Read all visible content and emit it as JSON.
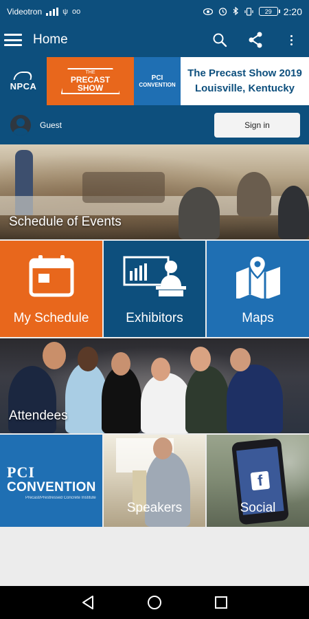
{
  "status_bar": {
    "carrier": "Videotron",
    "battery": "29",
    "time": "2:20"
  },
  "app_bar": {
    "title": "Home",
    "icons": [
      "menu-icon",
      "search-icon",
      "share-icon",
      "more-vert-icon"
    ]
  },
  "banner": {
    "npca_logo": "NPCA",
    "precast_logo_top": "THE",
    "precast_logo_line1": "PRECAST",
    "precast_logo_line2": "SHOW",
    "convention_logo_top": "PCI",
    "convention_logo_bottom": "CONVENTION",
    "show_title": "The Precast Show 2019",
    "show_location": "Louisville, Kentucky"
  },
  "guest_bar": {
    "user_label": "Guest",
    "sign_in_label": "Sign in"
  },
  "tiles": {
    "schedule_of_events": "Schedule of Events",
    "my_schedule": "My Schedule",
    "exhibitors": "Exhibitors",
    "maps": "Maps",
    "attendees": "Attendees",
    "convention_pci": "PCI",
    "convention_name": "CONVENTION",
    "convention_sub": "Precast/Prestressed Concrete Institute",
    "speakers": "Speakers",
    "social": "Social"
  },
  "colors": {
    "primary": "#0d4f7d",
    "accent_orange": "#e8671c",
    "accent_blue": "#1f6fb3"
  }
}
